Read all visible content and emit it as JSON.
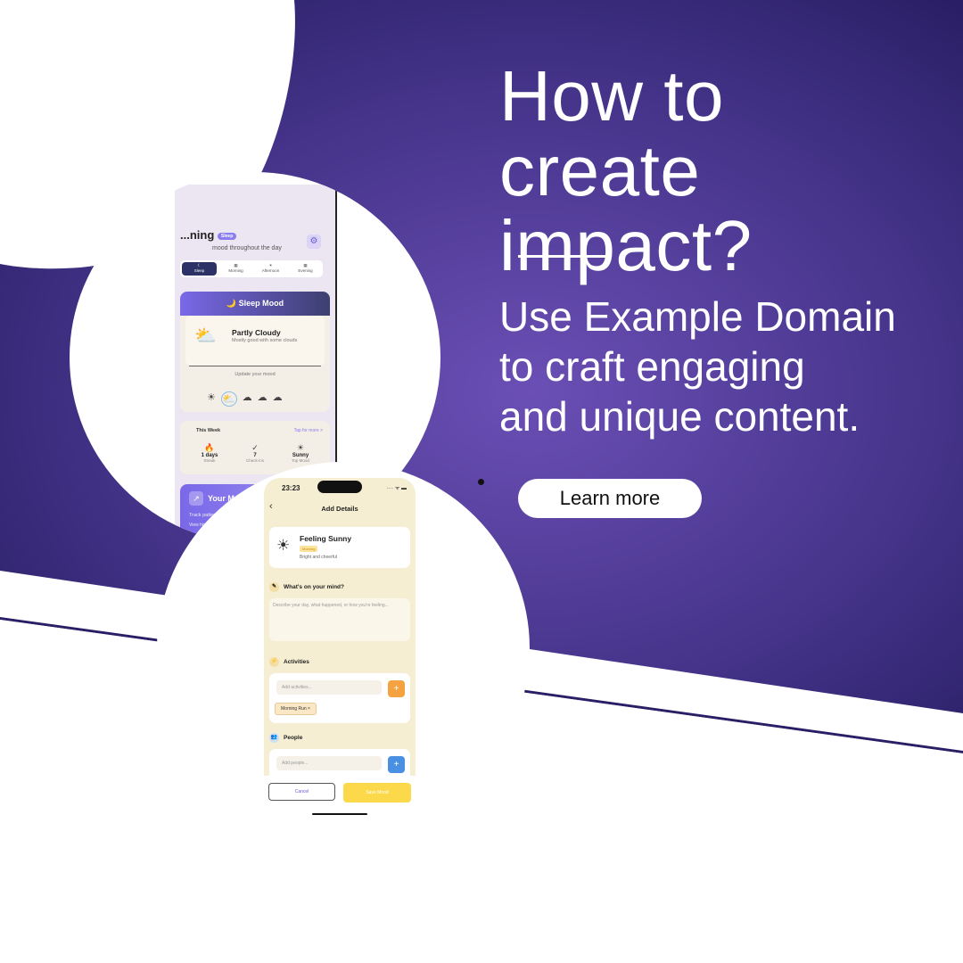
{
  "hero": {
    "headline_line1": "How to create",
    "headline_line2": "impact?",
    "sub_line1": "Use Example Domain",
    "sub_line2": "to craft engaging",
    "sub_line3": "and unique content.",
    "cta_label": "Learn more"
  },
  "colors": {
    "purple_dark": "#2a1f66",
    "purple_light": "#6b4fb5",
    "white": "#ffffff"
  },
  "phone_sleep": {
    "greeting": "...ning",
    "greeting_badge": "Sleep",
    "greeting_sub": "mood throughout the day",
    "tabs": [
      "Sleep",
      "Morning",
      "Afternoon",
      "Evening"
    ],
    "card_title": "🌙 Sleep Mood",
    "condition_title": "Partly Cloudy",
    "condition_sub": "Mostly good with some clouds",
    "update_label": "Update your mood",
    "week_title": "This Week",
    "week_more": "Tap for more  >",
    "stats": [
      {
        "icon": "🔥",
        "value": "1 days",
        "label": "Streak"
      },
      {
        "icon": "✓",
        "value": "7",
        "label": "Check-ins"
      },
      {
        "icon": "☀",
        "value": "Sunny",
        "label": "Top Mood"
      }
    ],
    "insight_title": "Your Mood...",
    "insight_sub": "Track patterns...",
    "insight_link": "View history..."
  },
  "phone_details": {
    "time": "23:23",
    "signal": "···· ᯤ ▬",
    "title": "Add Details",
    "mood_title": "Feeling Sunny",
    "mood_tag": "Morning",
    "mood_sub": "Bright and cheerful",
    "mind_title": "What's on your mind?",
    "mind_placeholder": "Describe your day, what happened, or how you're feeling...",
    "activities_title": "Activities",
    "activities_placeholder": "Add activities...",
    "activity_chip": "Morning Run  ×",
    "people_title": "People",
    "people_placeholder": "Add people...",
    "cancel_label": "Cancel",
    "save_label": "Save Mood"
  }
}
